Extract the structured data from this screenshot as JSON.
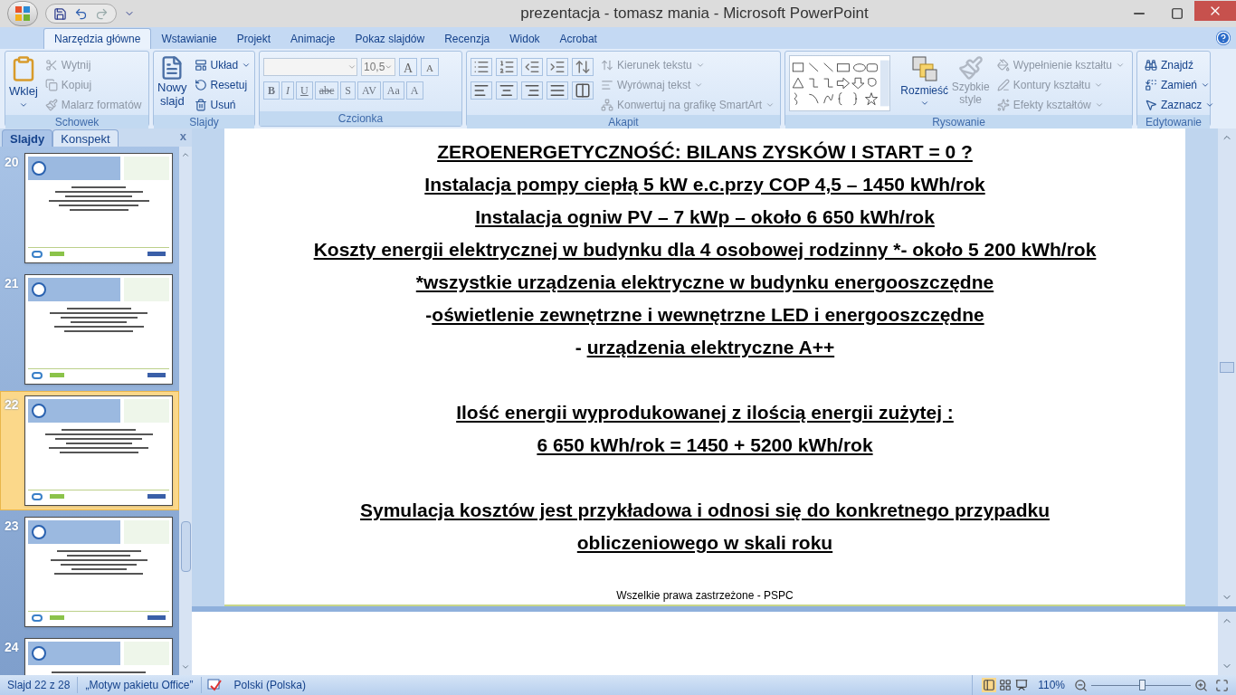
{
  "window": {
    "title": "prezentacja - tomasz mania - Microsoft PowerPoint"
  },
  "tabs": [
    {
      "label": "Narzędzia główne",
      "selected": true
    },
    {
      "label": "Wstawianie",
      "selected": false
    },
    {
      "label": "Projekt",
      "selected": false
    },
    {
      "label": "Animacje",
      "selected": false
    },
    {
      "label": "Pokaz slajdów",
      "selected": false
    },
    {
      "label": "Recenzja",
      "selected": false
    },
    {
      "label": "Widok",
      "selected": false
    },
    {
      "label": "Acrobat",
      "selected": false
    }
  ],
  "ribbon": {
    "clipboard": {
      "label": "Schowek",
      "big": "Wklej",
      "commands": [
        {
          "label": "Wytnij",
          "disabled": true
        },
        {
          "label": "Kopiuj",
          "disabled": true
        },
        {
          "label": "Malarz formatów",
          "disabled": true
        }
      ]
    },
    "slides": {
      "label": "Slajdy",
      "big": "Nowy slajd",
      "commands": [
        {
          "label": "Układ",
          "disabled": false
        },
        {
          "label": "Resetuj",
          "disabled": false
        },
        {
          "label": "Usuń",
          "disabled": false
        }
      ]
    },
    "font": {
      "label": "Czcionka",
      "size": "10,5",
      "size_buttons": [
        "A",
        "A"
      ],
      "buttons": [
        "B",
        "I",
        "U",
        "abc",
        "S",
        "AV",
        "Aa",
        "A"
      ]
    },
    "paragraph": {
      "label": "Akapit",
      "commands": [
        {
          "label": "Kierunek tekstu",
          "disabled": true
        },
        {
          "label": "Wyrównaj tekst",
          "disabled": true
        },
        {
          "label": "Konwertuj na grafikę SmartArt",
          "disabled": true
        }
      ]
    },
    "drawing": {
      "label": "Rysowanie",
      "arrange": "Rozmieść",
      "styles": "Szybkie style",
      "commands": [
        {
          "label": "Wypełnienie kształtu",
          "disabled": true
        },
        {
          "label": "Kontury kształtu",
          "disabled": true
        },
        {
          "label": "Efekty kształtów",
          "disabled": true
        }
      ]
    },
    "editing": {
      "label": "Edytowanie",
      "commands": [
        {
          "label": "Znajdź"
        },
        {
          "label": "Zamień"
        },
        {
          "label": "Zaznacz"
        }
      ]
    }
  },
  "panel": {
    "tabs": [
      {
        "label": "Slajdy",
        "selected": true
      },
      {
        "label": "Konspekt",
        "selected": false
      }
    ],
    "close": "x",
    "slides": [
      {
        "number": "20",
        "selected": false
      },
      {
        "number": "21",
        "selected": false
      },
      {
        "number": "22",
        "selected": true
      },
      {
        "number": "23",
        "selected": false
      },
      {
        "number": "24",
        "selected": false
      }
    ]
  },
  "slide": {
    "blocks": [
      [
        {
          "text": "ZEROENERGETYCZNOŚĆ:  BILANS ZYSKÓW I START = 0 ?"
        },
        {
          "text": "Instalacja pompy ciepłą 5 kW e.c.przy COP 4,5 –  1450 kWh/rok"
        },
        {
          "text": "Instalacja ogniw PV – 7 kWp – około 6 650 kWh/rok"
        },
        {
          "text": "Koszty energii elektrycznej w budynku dla 4 osobowej rodzinny *- około 5 200 kWh/rok"
        },
        {
          "text": "*wszystkie urządzenia elektryczne w budynku energooszczędne"
        },
        {
          "prefix": "-",
          "text": "oświetlenie zewnętrzne i wewnętrzne LED i energooszczędne"
        },
        {
          "prefix": "- ",
          "text": "urządzenia elektryczne A++"
        }
      ],
      [
        {
          "text": "Ilość energii wyprodukowanej z ilością energii zużytej :"
        },
        {
          "text": "6 650 kWh/rok = 1450 + 5200 kWh/rok"
        }
      ],
      [
        {
          "text": "Symulacja kosztów  jest przykładowa i odnosi się do konkretnego przypadku obliczeniowego w skali roku"
        }
      ]
    ],
    "footer": "Wszelkie prawa zastrzeżone - PSPC"
  },
  "status_bar": {
    "slide": "Slajd 22 z 28",
    "theme": "„Motyw pakietu Office”",
    "language": "Polski (Polska)",
    "zoom": "110%",
    "zoom_slider": {
      "level": 0.51
    }
  }
}
